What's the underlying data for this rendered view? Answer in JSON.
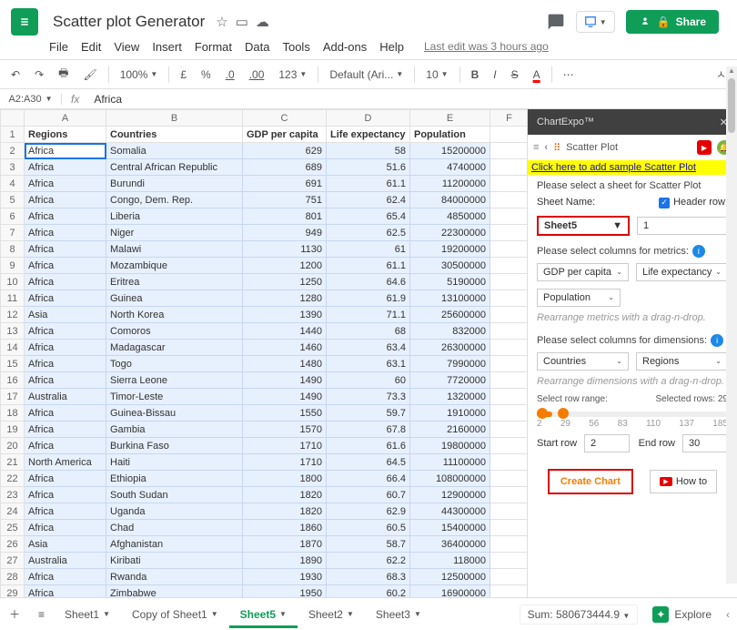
{
  "header": {
    "title": "Scatter plot Generator",
    "share": "Share",
    "last_edit": "Last edit was 3 hours ago"
  },
  "menus": [
    "File",
    "Edit",
    "View",
    "Insert",
    "Format",
    "Data",
    "Tools",
    "Add-ons",
    "Help"
  ],
  "toolbar": {
    "zoom": "100%",
    "currency": "£",
    "pct": "%",
    "dec0": ".0",
    "dec00": ".00",
    "num": "123",
    "font": "Default (Ari...",
    "size": "10"
  },
  "fx": {
    "ref": "A2:A30",
    "value": "Africa"
  },
  "columns": [
    "A",
    "B",
    "C",
    "D",
    "E",
    "F"
  ],
  "headers": [
    "Regions",
    "Countries",
    "GDP per capita",
    "Life expectancy",
    "Population"
  ],
  "rows": [
    [
      "Africa",
      "Somalia",
      629,
      58,
      15200000
    ],
    [
      "Africa",
      "Central African Republic",
      689,
      51.6,
      4740000
    ],
    [
      "Africa",
      "Burundi",
      691,
      61.1,
      11200000
    ],
    [
      "Africa",
      "Congo, Dem. Rep.",
      751,
      62.4,
      84000000
    ],
    [
      "Africa",
      "Liberia",
      801,
      65.4,
      4850000
    ],
    [
      "Africa",
      "Niger",
      949,
      62.5,
      22300000
    ],
    [
      "Africa",
      "Malawi",
      1130,
      61,
      19200000
    ],
    [
      "Africa",
      "Mozambique",
      1200,
      61.1,
      30500000
    ],
    [
      "Africa",
      "Eritrea",
      1250,
      64.6,
      5190000
    ],
    [
      "Africa",
      "Guinea",
      1280,
      61.9,
      13100000
    ],
    [
      "Asia",
      "North Korea",
      1390,
      71.1,
      25600000
    ],
    [
      "Africa",
      "Comoros",
      1440,
      68,
      832000
    ],
    [
      "Africa",
      "Madagascar",
      1460,
      63.4,
      26300000
    ],
    [
      "Africa",
      "Togo",
      1480,
      63.1,
      7990000
    ],
    [
      "Africa",
      "Sierra Leone",
      1490,
      60,
      7720000
    ],
    [
      "Australia",
      "Timor-Leste",
      1490,
      73.3,
      1320000
    ],
    [
      "Africa",
      "Guinea-Bissau",
      1550,
      59.7,
      1910000
    ],
    [
      "Africa",
      "Gambia",
      1570,
      67.8,
      2160000
    ],
    [
      "Africa",
      "Burkina Faso",
      1710,
      61.6,
      19800000
    ],
    [
      "North America",
      "Haiti",
      1710,
      64.5,
      11100000
    ],
    [
      "Africa",
      "Ethiopia",
      1800,
      66.4,
      108000000
    ],
    [
      "Africa",
      "South Sudan",
      1820,
      60.7,
      12900000
    ],
    [
      "Africa",
      "Uganda",
      1820,
      62.9,
      44300000
    ],
    [
      "Africa",
      "Chad",
      1860,
      60.5,
      15400000
    ],
    [
      "Asia",
      "Afghanistan",
      1870,
      58.7,
      36400000
    ],
    [
      "Australia",
      "Kiribati",
      1890,
      62.2,
      118000
    ],
    [
      "Africa",
      "Rwanda",
      1930,
      68.3,
      12500000
    ],
    [
      "Africa",
      "Zimbabwe",
      1950,
      60.2,
      16900000
    ]
  ],
  "tabs": [
    "Sheet1",
    "Copy of Sheet1",
    "Sheet5",
    "Sheet2",
    "Sheet3"
  ],
  "status": {
    "sum_label": "Sum: 580673444.9"
  },
  "panel": {
    "title": "ChartExpo™",
    "nav_title": "Scatter Plot",
    "sample_link": "Click here to add sample Scatter Plot",
    "select_sheet": "Please select a sheet for Scatter Plot",
    "sheet_name_label": "Sheet Name:",
    "header_row_label": "Header row:",
    "sheet_selected": "Sheet5",
    "header_val": "1",
    "metrics_label": "Please select columns for metrics:",
    "m1": "GDP per capita",
    "m2": "Life expectancy",
    "m3": "Population",
    "metrics_hint": "Rearrange metrics with a drag-n-drop.",
    "dim_label": "Please select columns for dimensions:",
    "d1": "Countries",
    "d2": "Regions",
    "dim_hint": "Rearrange dimensions with a drag-n-drop.",
    "range_lbl": "Select row range:",
    "selected_lbl": "Selected rows: 29",
    "ticks": [
      "2",
      "29",
      "56",
      "83",
      "110",
      "137",
      "185"
    ],
    "start_label": "Start row",
    "start_val": "2",
    "end_label": "End row",
    "end_val": "30",
    "create": "Create Chart",
    "howto": "How to"
  },
  "explore": "Explore"
}
